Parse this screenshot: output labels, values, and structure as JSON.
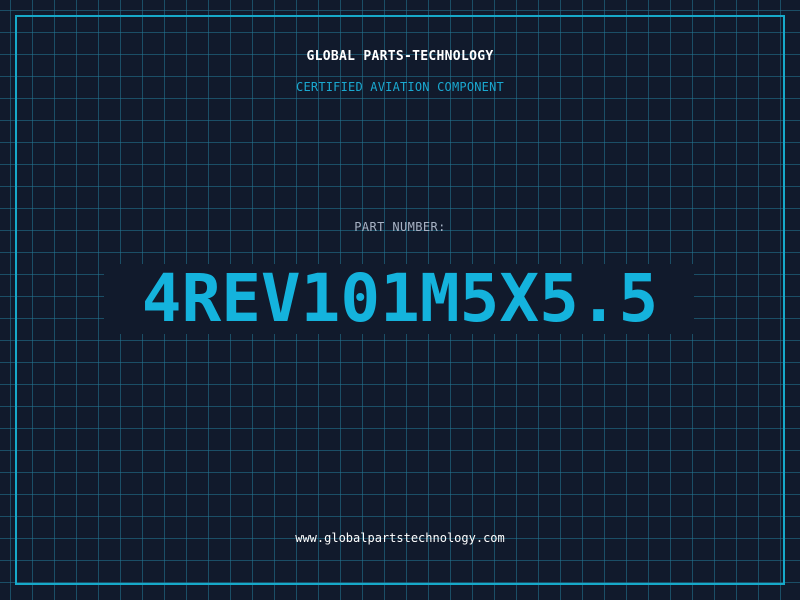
{
  "company_name": "GLOBAL PARTS-TECHNOLOGY",
  "tagline": "CERTIFIED AVIATION COMPONENT",
  "part_label": "PART NUMBER:",
  "part_number": "4REV101M5X5.5",
  "website": "www.globalpartstechnology.com",
  "colors": {
    "background": "#111a2c",
    "grid": "#23788f",
    "frame": "#17a9c9",
    "accent": "#14b3dd",
    "label": "#a8b2c4",
    "text": "#ffffff"
  }
}
